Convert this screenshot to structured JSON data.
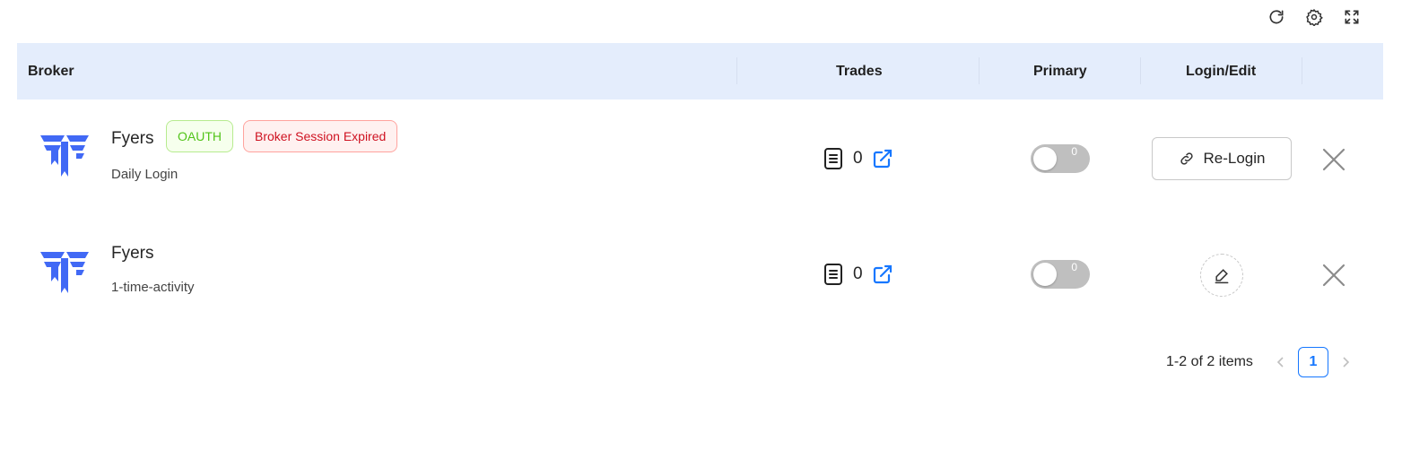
{
  "toolbar": {
    "icons": [
      "reload-icon",
      "settings-icon",
      "fullscreen-icon"
    ]
  },
  "table": {
    "columns": [
      "Broker",
      "Trades",
      "Primary",
      "Login/Edit"
    ],
    "rows": [
      {
        "broker_name": "Fyers",
        "tags": [
          "OAUTH",
          "Broker Session Expired"
        ],
        "subtitle": "Daily Login",
        "trades_count": "0",
        "primary_switch_text": "0",
        "primary_on": false,
        "action_label": "Re-Login"
      },
      {
        "broker_name": "Fyers",
        "tags": [],
        "subtitle": "1-time-activity",
        "trades_count": "0",
        "primary_switch_text": "0",
        "primary_on": false,
        "action_label": ""
      }
    ]
  },
  "pagination": {
    "total_text": "1-2 of 2 items",
    "current_page": "1"
  },
  "colors": {
    "header_bg": "#e4edfc",
    "accent": "#1677ff",
    "logo": "#4169f5",
    "oauth_tag": "#52c41a",
    "expired_tag": "#cf1322"
  }
}
